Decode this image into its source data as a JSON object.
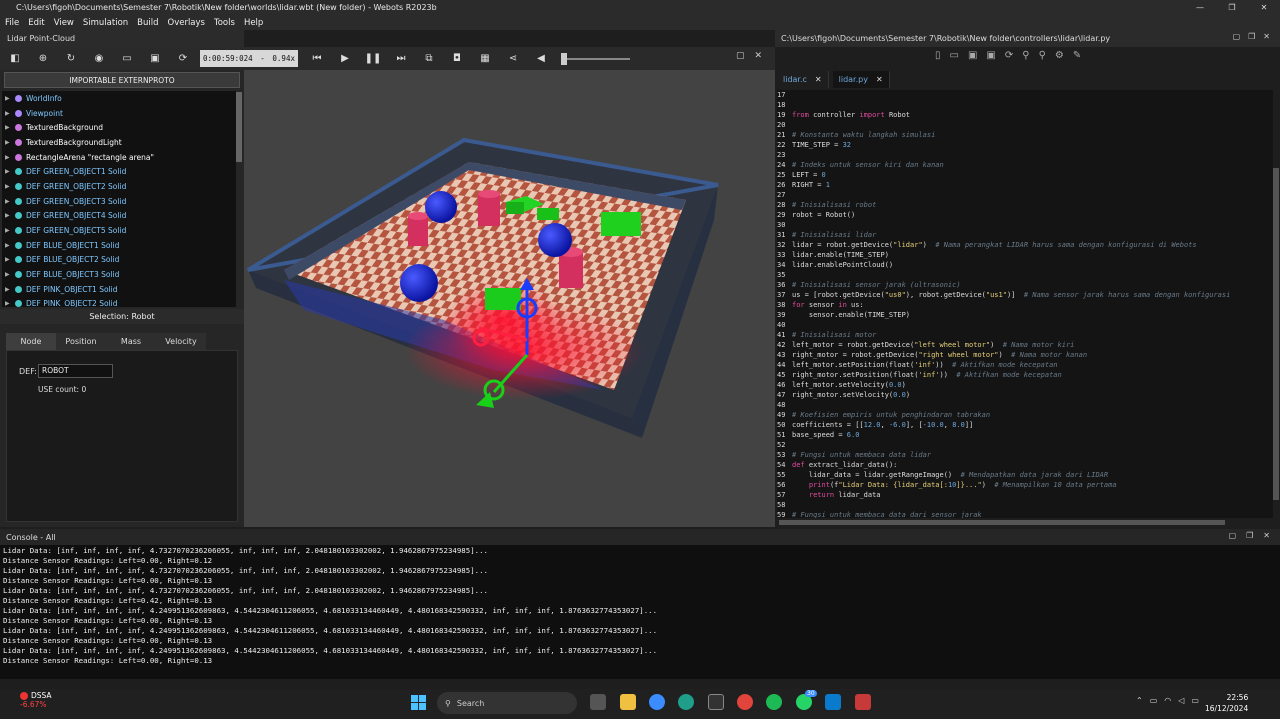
{
  "window": {
    "title": "C:\\Users\\figoh\\Documents\\Semester 7\\Robotik\\New folder\\worlds\\lidar.wbt (New folder) - Webots R2023b",
    "controls": [
      "—",
      "❐",
      "✕"
    ]
  },
  "menu": [
    "File",
    "Edit",
    "View",
    "Simulation",
    "Build",
    "Overlays",
    "Tools",
    "Help"
  ],
  "left_panel": {
    "title": "Lidar Point-Cloud",
    "import_button": "IMPORTABLE EXTERNPROTO",
    "tree": [
      {
        "label": "WorldInfo",
        "color": "#7ec8ff",
        "dot": "#aa88ff"
      },
      {
        "label": "Viewpoint",
        "color": "#7ec8ff",
        "dot": "#aa88ff"
      },
      {
        "label": "TexturedBackground",
        "color": "#ffffff",
        "dot": "#cc77dd"
      },
      {
        "label": "TexturedBackgroundLight",
        "color": "#ffffff",
        "dot": "#cc77dd"
      },
      {
        "label": "RectangleArena \"rectangle arena\"",
        "color": "#ffffff",
        "dot": "#cc77dd"
      },
      {
        "label": "DEF GREEN_OBJECT1 Solid",
        "color": "#7ec8ff",
        "dot": "#44c8c8"
      },
      {
        "label": "DEF GREEN_OBJECT2 Solid",
        "color": "#7ec8ff",
        "dot": "#44c8c8"
      },
      {
        "label": "DEF GREEN_OBJECT3 Solid",
        "color": "#7ec8ff",
        "dot": "#44c8c8"
      },
      {
        "label": "DEF GREEN_OBJECT4 Solid",
        "color": "#7ec8ff",
        "dot": "#44c8c8"
      },
      {
        "label": "DEF GREEN_OBJECT5 Solid",
        "color": "#7ec8ff",
        "dot": "#44c8c8"
      },
      {
        "label": "DEF BLUE_OBJECT1 Solid",
        "color": "#7ec8ff",
        "dot": "#44c8c8"
      },
      {
        "label": "DEF BLUE_OBJECT2 Solid",
        "color": "#7ec8ff",
        "dot": "#44c8c8"
      },
      {
        "label": "DEF BLUE_OBJECT3 Solid",
        "color": "#7ec8ff",
        "dot": "#44c8c8"
      },
      {
        "label": "DEF PINK_OBJECT1 Solid",
        "color": "#7ec8ff",
        "dot": "#44c8c8"
      },
      {
        "label": "DEF PINK_OBJECT2 Solid",
        "color": "#7ec8ff",
        "dot": "#44c8c8"
      }
    ],
    "selection": "Selection: Robot",
    "tabs": [
      "Node",
      "Position",
      "Mass",
      "Velocity"
    ],
    "def_label": "DEF:",
    "def_value": "ROBOT",
    "use_count": "USE count: 0"
  },
  "sim_toolbar": {
    "time": "0:00:59:024",
    "speed_sep": "-",
    "speed": "0.94x"
  },
  "editor": {
    "path": "C:\\Users\\figoh\\Documents\\Semester 7\\Robotik\\New folder\\controllers\\lidar\\lidar.py",
    "tabs": [
      {
        "label": "lidar.c",
        "close": "✕"
      },
      {
        "label": "lidar.py",
        "close": "✕"
      }
    ],
    "lines": [
      {
        "n": "17",
        "t": ""
      },
      {
        "n": "18",
        "t": ""
      },
      {
        "n": "19",
        "t": "from controller import Robot"
      },
      {
        "n": "20",
        "t": ""
      },
      {
        "n": "21",
        "t": "# Konstanta waktu langkah simulasi"
      },
      {
        "n": "22",
        "t": "TIME_STEP = 32"
      },
      {
        "n": "23",
        "t": ""
      },
      {
        "n": "24",
        "t": "# Indeks untuk sensor kiri dan kanan"
      },
      {
        "n": "25",
        "t": "LEFT = 0"
      },
      {
        "n": "26",
        "t": "RIGHT = 1"
      },
      {
        "n": "27",
        "t": ""
      },
      {
        "n": "28",
        "t": "# Inisialisasi robot"
      },
      {
        "n": "29",
        "t": "robot = Robot()"
      },
      {
        "n": "30",
        "t": ""
      },
      {
        "n": "31",
        "t": "# Inisialisasi lidar"
      },
      {
        "n": "32",
        "t": "lidar = robot.getDevice(\"lidar\")  # Nama perangkat LIDAR harus sama dengan konfigurasi di Webots"
      },
      {
        "n": "33",
        "t": "lidar.enable(TIME_STEP)"
      },
      {
        "n": "34",
        "t": "lidar.enablePointCloud()"
      },
      {
        "n": "35",
        "t": ""
      },
      {
        "n": "36",
        "t": "# Inisialisasi sensor jarak (ultrasonic)"
      },
      {
        "n": "37",
        "t": "us = [robot.getDevice(\"us0\"), robot.getDevice(\"us1\")]  # Nama sensor jarak harus sama dengan konfigurasi"
      },
      {
        "n": "38",
        "t": "for sensor in us:"
      },
      {
        "n": "39",
        "t": "    sensor.enable(TIME_STEP)"
      },
      {
        "n": "40",
        "t": ""
      },
      {
        "n": "41",
        "t": "# Inisialisasi motor"
      },
      {
        "n": "42",
        "t": "left_motor = robot.getDevice(\"left wheel motor\")  # Nama motor kiri"
      },
      {
        "n": "43",
        "t": "right_motor = robot.getDevice(\"right wheel motor\")  # Nama motor kanan"
      },
      {
        "n": "44",
        "t": "left_motor.setPosition(float('inf'))  # Aktifkan mode kecepatan"
      },
      {
        "n": "45",
        "t": "right_motor.setPosition(float('inf'))  # Aktifkan mode kecepatan"
      },
      {
        "n": "46",
        "t": "left_motor.setVelocity(0.0)"
      },
      {
        "n": "47",
        "t": "right_motor.setVelocity(0.0)"
      },
      {
        "n": "48",
        "t": ""
      },
      {
        "n": "49",
        "t": "# Koefisien empiris untuk penghindaran tabrakan"
      },
      {
        "n": "50",
        "t": "coefficients = [[12.0, -6.0], [-10.0, 8.0]]"
      },
      {
        "n": "51",
        "t": "base_speed = 6.0"
      },
      {
        "n": "52",
        "t": ""
      },
      {
        "n": "53",
        "t": "# Fungsi untuk membaca data lidar"
      },
      {
        "n": "54",
        "t": "def extract_lidar_data():"
      },
      {
        "n": "55",
        "t": "    lidar_data = lidar.getRangeImage()  # Mendapatkan data jarak dari LIDAR"
      },
      {
        "n": "56",
        "t": "    print(f\"Lidar Data: {lidar_data[:10]}...\")  # Menampilkan 10 data pertama"
      },
      {
        "n": "57",
        "t": "    return lidar_data"
      },
      {
        "n": "58",
        "t": ""
      },
      {
        "n": "59",
        "t": "# Fungsi untuk membaca data dari sensor jarak"
      }
    ]
  },
  "console": {
    "title": "Console - All",
    "lines": [
      "Lidar Data: [inf, inf, inf, inf, 4.7327070236206055, inf, inf, inf, 2.048180103302002, 1.9462867975234985]...",
      "Distance Sensor Readings: Left=0.00, Right=0.12",
      "Lidar Data: [inf, inf, inf, inf, 4.7327070236206055, inf, inf, inf, 2.048180103302002, 1.9462867975234985]...",
      "Distance Sensor Readings: Left=0.00, Right=0.13",
      "Lidar Data: [inf, inf, inf, inf, 4.7327070236206055, inf, inf, inf, 2.048180103302002, 1.9462867975234985]...",
      "Distance Sensor Readings: Left=0.42, Right=0.13",
      "Lidar Data: [inf, inf, inf, inf, 4.249951362609863, 4.5442304611206055, 4.681033134460449, 4.480168342590332, inf, inf, inf, 1.8763632774353027]...",
      "Distance Sensor Readings: Left=0.00, Right=0.13",
      "Lidar Data: [inf, inf, inf, inf, 4.249951362609863, 4.5442304611206055, 4.681033134460449, 4.480168342590332, inf, inf, inf, 1.8763632774353027]...",
      "Distance Sensor Readings: Left=0.00, Right=0.13",
      "Lidar Data: [inf, inf, inf, inf, 4.249951362609863, 4.5442304611206055, 4.681033134460449, 4.480168342590332, inf, inf, inf, 1.8763632774353027]...",
      "Distance Sensor Readings: Left=0.00, Right=0.13"
    ]
  },
  "taskbar": {
    "stock_name": "DSSA",
    "stock_change": "-6.67%",
    "search_placeholder": "Search",
    "time": "22:56",
    "date": "16/12/2024",
    "whatsapp_badge": "30"
  }
}
